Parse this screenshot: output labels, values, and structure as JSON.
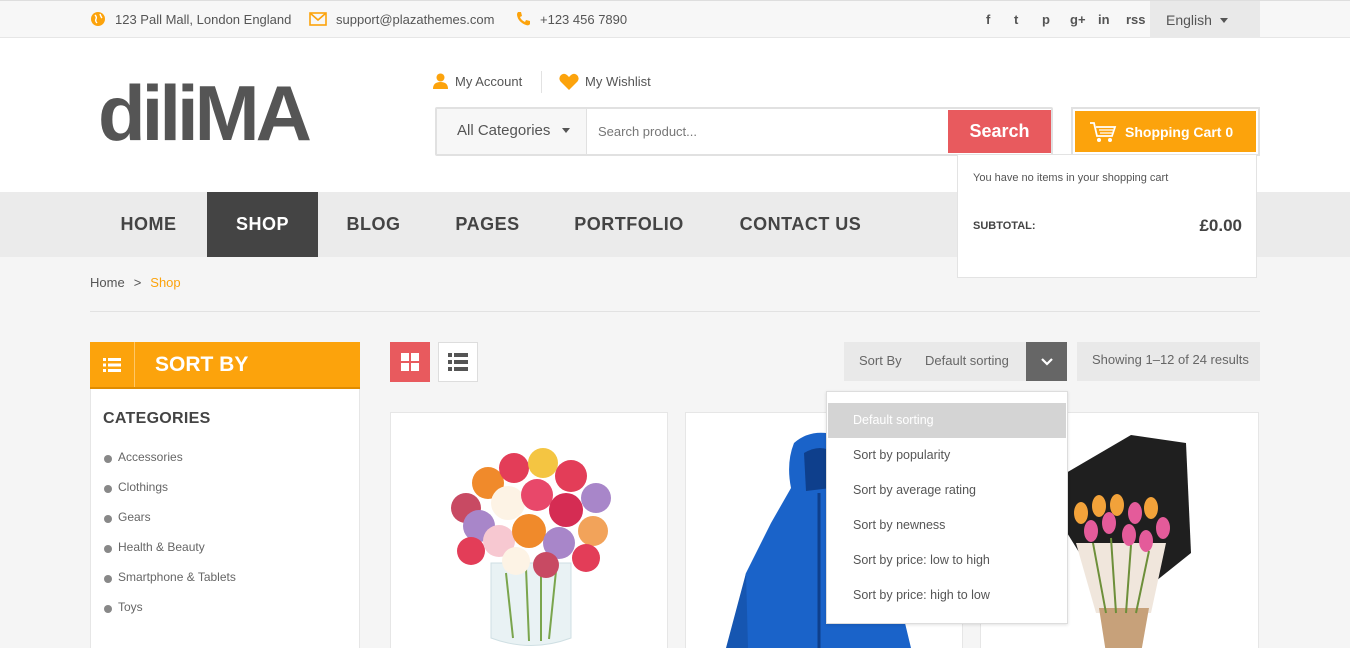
{
  "topbar": {
    "address": "123 Pall Mall, London England",
    "email": "support@plazathemes.com",
    "phone": "+123 456 7890",
    "social": [
      "f",
      "t",
      "p",
      "g+",
      "in",
      "rss"
    ],
    "language": "English"
  },
  "header": {
    "logo_text": "diliMA",
    "my_account": "My Account",
    "my_wishlist": "My Wishlist",
    "category_select": "All Categories",
    "search_placeholder": "Search product...",
    "search_button": "Search",
    "cart_label": "Shopping Cart 0"
  },
  "cart_dropdown": {
    "message": "You have no items in your shopping cart",
    "subtotal_label": "SUBTOTAL:",
    "subtotal_value": "£0.00"
  },
  "nav": [
    "HOME",
    "SHOP",
    "BLOG",
    "PAGES",
    "PORTFOLIO",
    "CONTACT US"
  ],
  "breadcrumb": {
    "home": "Home",
    "separator": ">",
    "current": "Shop"
  },
  "sidebar": {
    "sort_title": "SORT BY",
    "categories_title": "CATEGORIES",
    "categories": [
      "Accessories",
      "Clothings",
      "Gears",
      "Health & Beauty",
      "Smartphone & Tablets",
      "Toys"
    ]
  },
  "toolbar": {
    "sort_label": "Sort By",
    "sort_value": "Default sorting",
    "showing": "Showing 1–12 of 24 results"
  },
  "sort_options": [
    "Default sorting",
    "Sort by popularity",
    "Sort by average rating",
    "Sort by newness",
    "Sort by price: low to high",
    "Sort by price: high to low"
  ],
  "products": [
    {
      "image": "rose-bouquet-vase"
    },
    {
      "image": "blue-jacket"
    },
    {
      "image": "tulip-bouquet"
    }
  ],
  "colors": {
    "accent": "#fca30c",
    "search_red": "#e85a5e",
    "nav_active": "#444444"
  }
}
